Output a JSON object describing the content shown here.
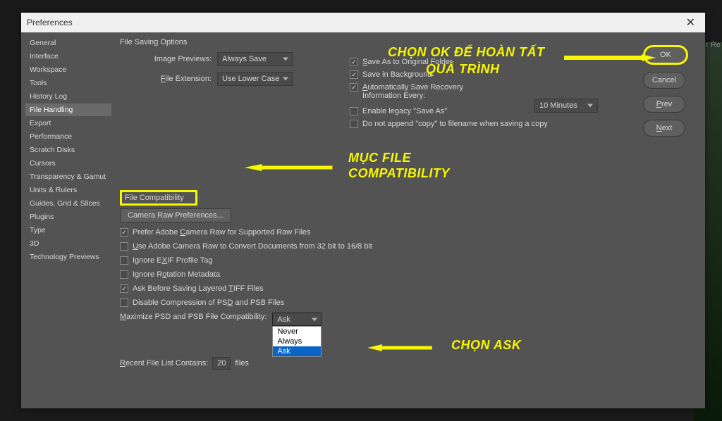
{
  "window": {
    "title": "Preferences"
  },
  "sidebar": {
    "items": [
      {
        "label": "General"
      },
      {
        "label": "Interface"
      },
      {
        "label": "Workspace"
      },
      {
        "label": "Tools"
      },
      {
        "label": "History Log"
      },
      {
        "label": "File Handling",
        "selected": true
      },
      {
        "label": "Export"
      },
      {
        "label": "Performance"
      },
      {
        "label": "Scratch Disks"
      },
      {
        "label": "Cursors"
      },
      {
        "label": "Transparency & Gamut"
      },
      {
        "label": "Units & Rulers"
      },
      {
        "label": "Guides, Grid & Slices"
      },
      {
        "label": "Plugins"
      },
      {
        "label": "Type"
      },
      {
        "label": "3D"
      },
      {
        "label": "Technology Previews"
      }
    ]
  },
  "saving": {
    "section": "File Saving Options",
    "image_previews_label": "Image Previews:",
    "image_previews_value": "Always Save",
    "file_extension_label": "File Extension:",
    "file_extension_value": "Use Lower Case",
    "save_original": "Save As to Original Folder",
    "save_bg": "Save in Background",
    "auto_recovery": "Automatically Save Recovery Information Every:",
    "recovery_value": "10 Minutes",
    "enable_legacy": "Enable legacy \"Save As\"",
    "no_append": "Do not append \"copy\" to filename when saving a copy"
  },
  "compat": {
    "section": "File Compatibility",
    "camera_raw_btn": "Camera Raw Preferences...",
    "prefer_raw": "Prefer Adobe Camera Raw for Supported Raw Files",
    "use_raw_convert": "Use Adobe Camera Raw to Convert Documents from 32 bit to 16/8 bit",
    "ignore_exif": "Ignore EXIF Profile Tag",
    "ignore_rotation": "Ignore Rotation Metadata",
    "ask_tiff": "Ask Before Saving Layered TIFF Files",
    "disable_psd": "Disable Compression of PSD and PSB Files",
    "maximize_label": "Maximize PSD and PSB File Compatibility:",
    "maximize_value": "Ask",
    "maximize_options": [
      "Never",
      "Always",
      "Ask"
    ]
  },
  "recent": {
    "label": "Recent File List Contains:",
    "value": "20",
    "suffix": "files"
  },
  "buttons": {
    "ok": "OK",
    "cancel": "Cancel",
    "prev": "Prev",
    "next": "Next"
  },
  "annotations": {
    "ok_line1": "CHỌN OK ĐỂ HOÀN TẤT",
    "ok_line2": "QUÁ TRÌNH",
    "compat_line1": "MỤC FILE",
    "compat_line2": "COMPATIBILITY",
    "ask": "CHỌN ASK"
  },
  "bg": {
    "r_text": "r Re"
  }
}
